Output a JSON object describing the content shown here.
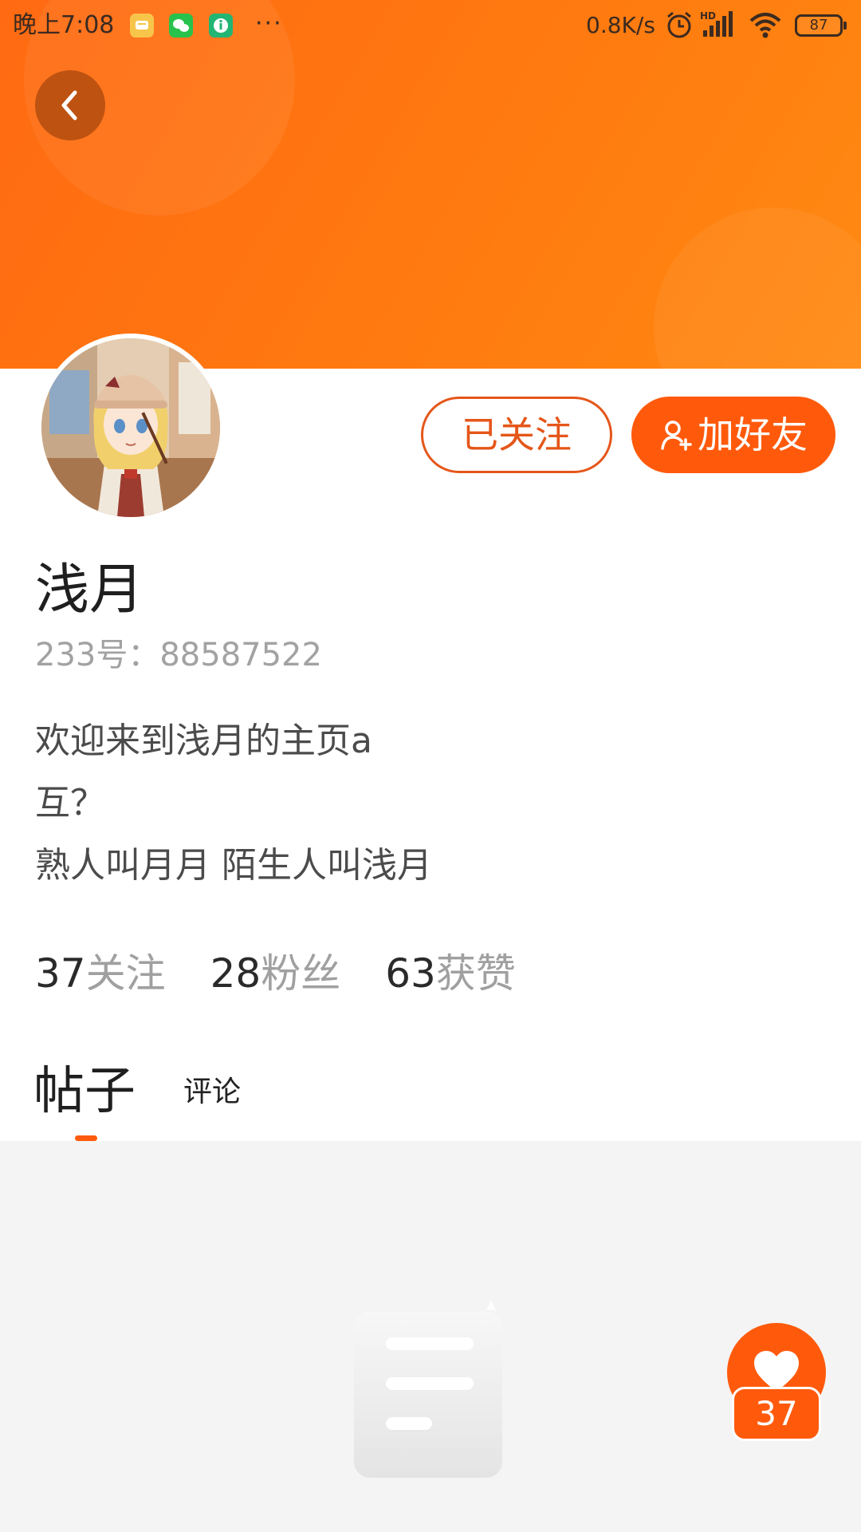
{
  "status_bar": {
    "time": "晚上7:08",
    "more": "···",
    "network_speed": "0.8K/s",
    "battery": "87",
    "apps": [
      "messages-app-icon",
      "wechat-app-icon",
      "info-app-icon"
    ],
    "icons": [
      "alarm-icon",
      "hd-signal-icon",
      "wifi-icon",
      "battery-icon"
    ]
  },
  "header": {
    "back_icon": "chevron-left-icon",
    "banner_color": "#ff7a10"
  },
  "profile": {
    "username": "浅月",
    "user_id": "233号：88587522",
    "bio_lines": [
      "欢迎来到浅月的主页a",
      "互？",
      "熟人叫月月 陌生人叫浅月"
    ],
    "avatar": "anime-girl-avatar"
  },
  "actions": {
    "follow_label": "已关注",
    "add_friend_label": "加好友",
    "add_friend_icon": "add-person-icon",
    "accent_color": "#ff5a0c"
  },
  "stats": {
    "following_count": "37",
    "following_label": "关注",
    "followers_count": "28",
    "followers_label": "粉丝",
    "likes_count": "63",
    "likes_label": "获赞"
  },
  "tabs": {
    "posts_label": "帖子",
    "comments_label": "评论",
    "active": "posts"
  },
  "empty_state": {
    "icon": "empty-document-icon"
  },
  "like_button": {
    "icon": "heart-icon",
    "count": "37"
  }
}
